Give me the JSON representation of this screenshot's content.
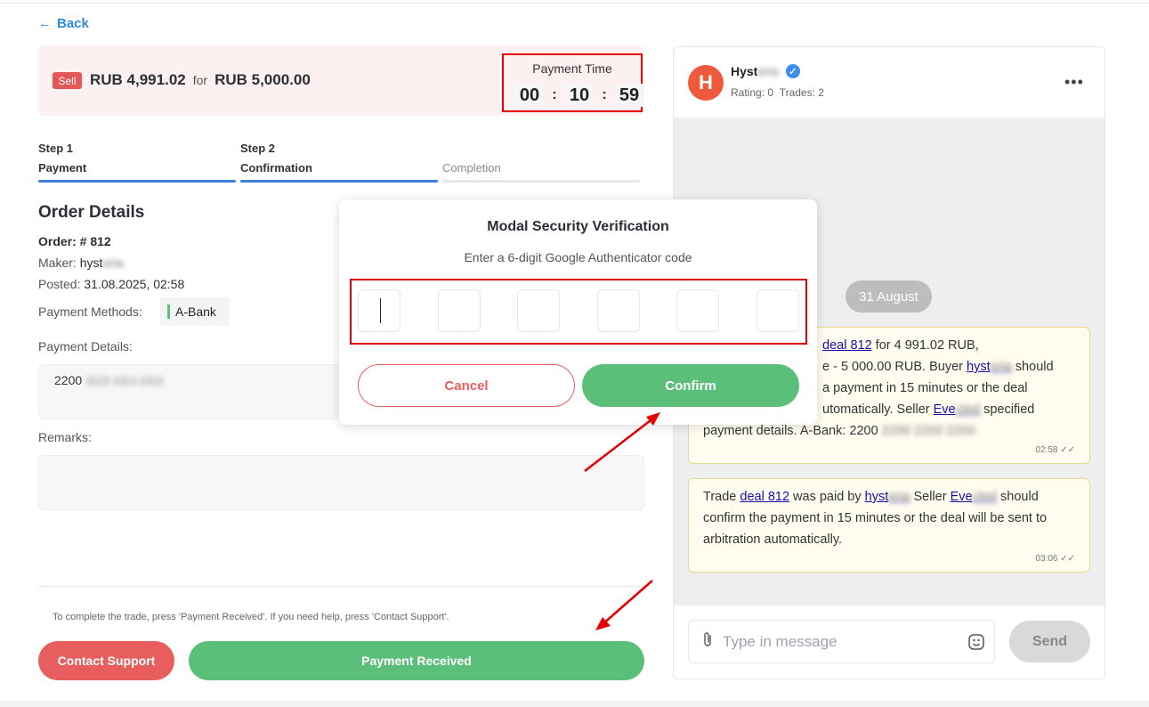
{
  "nav": {
    "back_label": "Back"
  },
  "trade": {
    "badge": "Sell",
    "sell_amount": "RUB 4,991.02",
    "for_word": "for",
    "buy_amount": "RUB 5,000.00"
  },
  "payment_time": {
    "label": "Payment Time",
    "hours": "00",
    "minutes": "10",
    "seconds": "59"
  },
  "steps": [
    {
      "number": "Step 1",
      "label": "Payment",
      "active": true
    },
    {
      "number": "Step 2",
      "label": "Confirmation",
      "active": true
    },
    {
      "number": "",
      "label": "Completion",
      "active": false
    }
  ],
  "order": {
    "title": "Order Details",
    "order_label": "Order: # 812",
    "maker_label": "Maker:",
    "maker_value": "hyst",
    "maker_blurred": "eria",
    "posted_label": "Posted:",
    "posted_value": "31.08.2025, 02:58",
    "methods_label": "Payment Methods:",
    "method": "A-Bank",
    "details_label": "Payment Details:",
    "details_value": "2200",
    "details_blurred": "3123 1313 1313",
    "remarks_label": "Remarks:"
  },
  "footer": {
    "hint": "To complete the trade, press 'Payment Received'. If you need help, press 'Contact Support'.",
    "support_label": "Contact Support",
    "received_label": "Payment Received"
  },
  "chat": {
    "avatar_letter": "H",
    "user_name": "Hyst",
    "user_name_blurred": "eria",
    "rating": "Rating: 0",
    "trades": "Trades: 2",
    "date_pill": "31 August",
    "messages": [
      {
        "time": "02:58",
        "deal_link": "deal 812",
        "p1_tail": " for 4 991.02 RUB,",
        "p2": "e - 5 000.00 RUB. Buyer ",
        "buyer": "hyst",
        "buyer_blurred": "eria",
        "p2_tail": " should",
        "p3": "a payment in 15 minutes or the deal",
        "p4": "utomatically. Seller ",
        "seller": "Eve",
        "seller_blurred": "cted",
        "p4_tail": " specified",
        "p5": "payment details. A-Bank: 2200 ",
        "p5_blurred": "2200 2200 2200"
      },
      {
        "time": "03:06",
        "text_a": "Trade ",
        "deal_link": "deal 812",
        "text_b": " was paid by ",
        "buyer": "hyst",
        "buyer_blurred": "eria",
        "text_c": " Seller ",
        "seller": "Eve",
        "seller_blurred": "cted",
        "text_d": " should confirm the payment in 15 minutes or the deal will be sent to arbitration automatically."
      }
    ],
    "input_placeholder": "Type in message",
    "send_label": "Send"
  },
  "modal": {
    "title": "Modal Security Verification",
    "subtitle": "Enter a 6-digit Google Authenticator code",
    "cancel_label": "Cancel",
    "confirm_label": "Confirm"
  },
  "colors": {
    "accent_green": "#5bbf7a",
    "accent_red": "#e85d5d",
    "link_blue": "#2e8bdc",
    "highlight_red": "#e60000"
  }
}
